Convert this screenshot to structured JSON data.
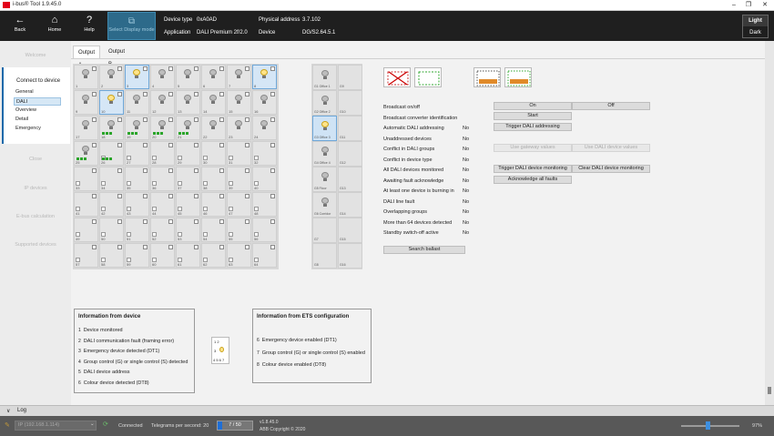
{
  "window": {
    "title": "i-bus® Tool 1.9.45.0"
  },
  "toolbar": {
    "back": "Back",
    "home": "Home",
    "help": "Help",
    "select_display": "Select Display mode",
    "device_type_label": "Device type",
    "device_type_value": "0xA0AD",
    "application_label": "Application",
    "application_value": "DALI Premium 2f/2.0",
    "physical_address_label": "Physical address",
    "physical_address_value": "3.7.102",
    "device_label": "Device",
    "device_value": "DG/S2.64.5.1",
    "theme_light": "Light",
    "theme_dark": "Dark"
  },
  "sidebar": {
    "welcome": "Welcome",
    "connect_header": "Connect to device",
    "items": [
      "General",
      "DALI",
      "Overview",
      "Detail",
      "Emergency"
    ],
    "active_item": "DALI",
    "grey_items": [
      "Close",
      "IP devices",
      "E-bus calculation",
      "Supported devices"
    ]
  },
  "tabs": [
    "Output A",
    "Output B"
  ],
  "active_tab": "Output A",
  "device_grid": {
    "numbers": [
      "1",
      "2",
      "3",
      "4",
      "5",
      "6",
      "7",
      "8",
      "9",
      "10",
      "11",
      "12",
      "13",
      "14",
      "15",
      "16",
      "17",
      "18",
      "19",
      "20",
      "21",
      "22",
      "23",
      "24",
      "25",
      "26",
      "27",
      "28",
      "29",
      "30",
      "31",
      "32",
      "33",
      "34",
      "35",
      "36",
      "37",
      "38",
      "39",
      "40",
      "41",
      "42",
      "43",
      "44",
      "45",
      "46",
      "47",
      "48",
      "49",
      "50",
      "51",
      "52",
      "53",
      "54",
      "55",
      "56",
      "57",
      "58",
      "59",
      "60",
      "61",
      "62",
      "63",
      "64"
    ]
  },
  "groups": {
    "labels": [
      "G1 Office 1",
      "G9",
      "G2 Office 2",
      "G10",
      "G3 Office 3",
      "G11",
      "G4 Office 4",
      "G12",
      "G5 Floor",
      "G13",
      "G6 Corridor",
      "G14",
      "G7",
      "G15",
      "G8",
      "G16"
    ]
  },
  "status": {
    "rows": [
      {
        "label": "Broadcast on/off",
        "value": ""
      },
      {
        "label": "Broadcast converter identification",
        "value": ""
      },
      {
        "label": "Automatic DALI addressing",
        "value": "No"
      },
      {
        "label": "Unaddressed devices",
        "value": "No"
      },
      {
        "label": "Conflict in DALI groups",
        "value": "No"
      },
      {
        "label": "Conflict in device type",
        "value": "No"
      },
      {
        "label": "All DALI devices monitored",
        "value": "No"
      },
      {
        "label": "Awaiting fault acknowledge",
        "value": "No"
      },
      {
        "label": "At least one device is burning in",
        "value": "No"
      },
      {
        "label": "DALI line fault",
        "value": "No"
      },
      {
        "label": "Overlapping groups",
        "value": "No"
      },
      {
        "label": "More than 64 devices detected",
        "value": "No"
      },
      {
        "label": "Standby switch-off active",
        "value": "No"
      }
    ],
    "search_ballast": "Search ballast"
  },
  "actions": {
    "on": "On",
    "off": "Off",
    "start": "Start",
    "trigger_addressing": "Trigger DALI addressing",
    "use_gateway": "Use gateway values",
    "use_dali": "Use DALI device values",
    "trigger_monitoring": "Trigger DALI device monitoring",
    "clear_monitoring": "Clear DALI device monitoring",
    "ack_faults": "Acknowledge all faults"
  },
  "info_device": {
    "title": "Information from device",
    "rows": [
      {
        "n": "1",
        "t": "Device monitored"
      },
      {
        "n": "2",
        "t": "DALI communication fault (framing error)"
      },
      {
        "n": "3",
        "t": "Emergency device detected (DT1)"
      },
      {
        "n": "4",
        "t": "Group control (G) or single control (S) detected"
      },
      {
        "n": "5",
        "t": "DALI device address"
      },
      {
        "n": "6",
        "t": "Colour device detected (DT8)"
      }
    ]
  },
  "info_ets": {
    "title": "Information from ETS configuration",
    "rows": [
      {
        "n": "6",
        "t": "Emergency device enabled (DT1)"
      },
      {
        "n": "7",
        "t": "Group control (G) or single control (S) enabled"
      },
      {
        "n": "8",
        "t": "Colour device enabled (DT8)"
      }
    ]
  },
  "legend_mini": {
    "r1": "1 2",
    "r2": "3",
    "r3": "4 5 6 7"
  },
  "log": {
    "label": "Log"
  },
  "statusbar": {
    "ip": "IP (192.168.1.114)",
    "connected": "Connected",
    "telegrams": "Telegrams per second: 20",
    "progress_text": "7 / 50",
    "progress": 0.14,
    "version": "v1.8.45.0",
    "copyright": "ABB Copyright © 2020",
    "zoom": "97%"
  },
  "colors": {
    "accent": "#1769aa",
    "toolbar": "#1f1f1f",
    "selected": "#2d6a8a",
    "bulb_on": "#ffe48a"
  }
}
